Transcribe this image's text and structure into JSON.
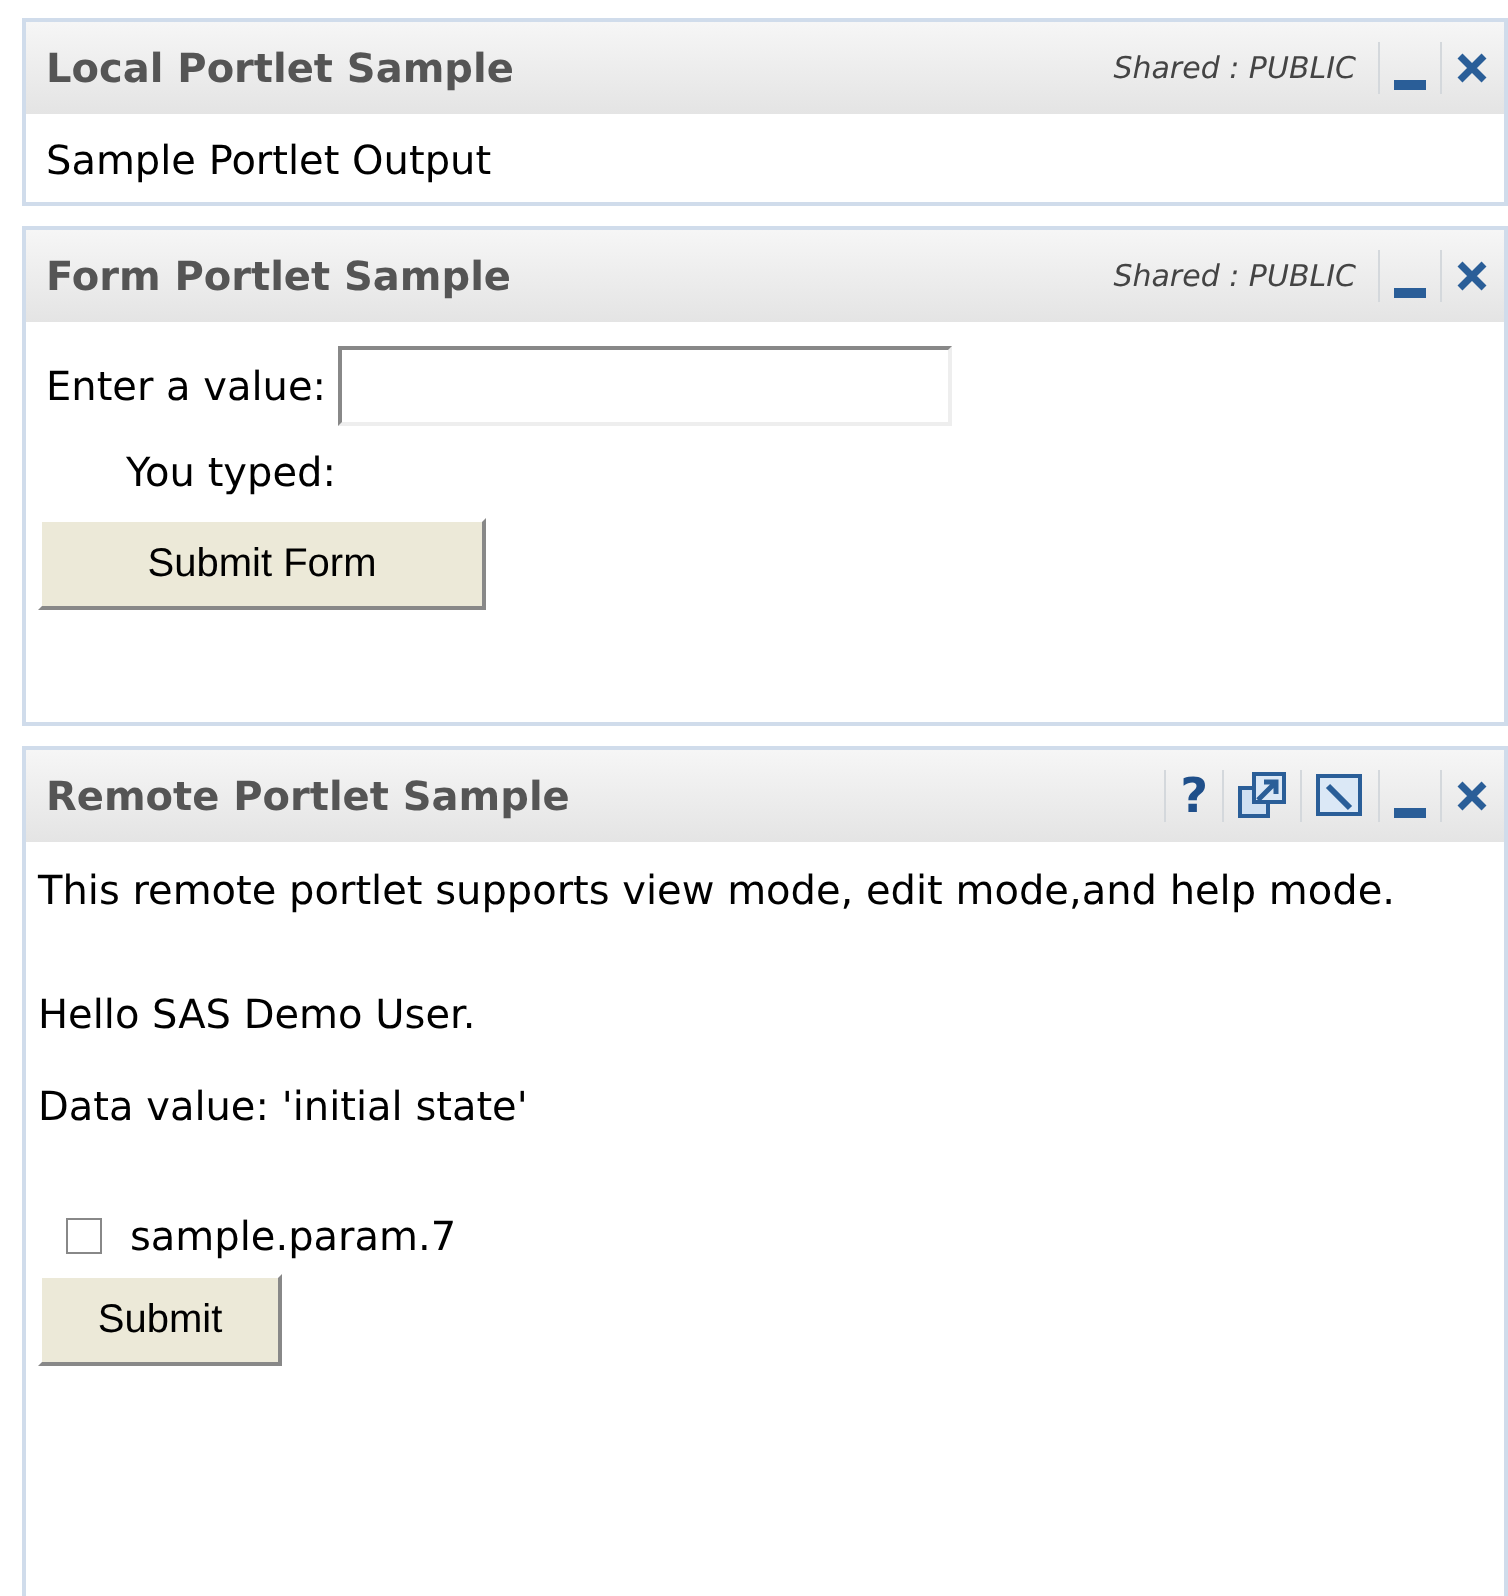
{
  "portlets": [
    {
      "title": "Local Portlet Sample",
      "shared": "Shared : PUBLIC",
      "tools": [
        {
          "kind": "minimize"
        },
        {
          "kind": "close"
        }
      ],
      "kind": "text",
      "text": "Sample Portlet Output"
    },
    {
      "title": "Form Portlet Sample",
      "shared": "Shared : PUBLIC",
      "tools": [
        {
          "kind": "minimize"
        },
        {
          "kind": "close"
        }
      ],
      "kind": "form",
      "field_label": "Enter a value:",
      "typed_label": "You typed:",
      "button": "Submit Form"
    },
    {
      "title": "Remote Portlet Sample",
      "tools": [
        {
          "kind": "help",
          "text": "?"
        },
        {
          "kind": "popout"
        },
        {
          "kind": "edit"
        },
        {
          "kind": "minimize"
        },
        {
          "kind": "close"
        }
      ],
      "kind": "remote",
      "paragraphs": [
        "This remote portlet supports view mode, edit mode,and help mode.",
        "Hello SAS Demo User.",
        "Data value: 'initial state'"
      ],
      "checkbox": {
        "label": "sample.param.7",
        "checked": false
      },
      "button": "Submit"
    }
  ]
}
